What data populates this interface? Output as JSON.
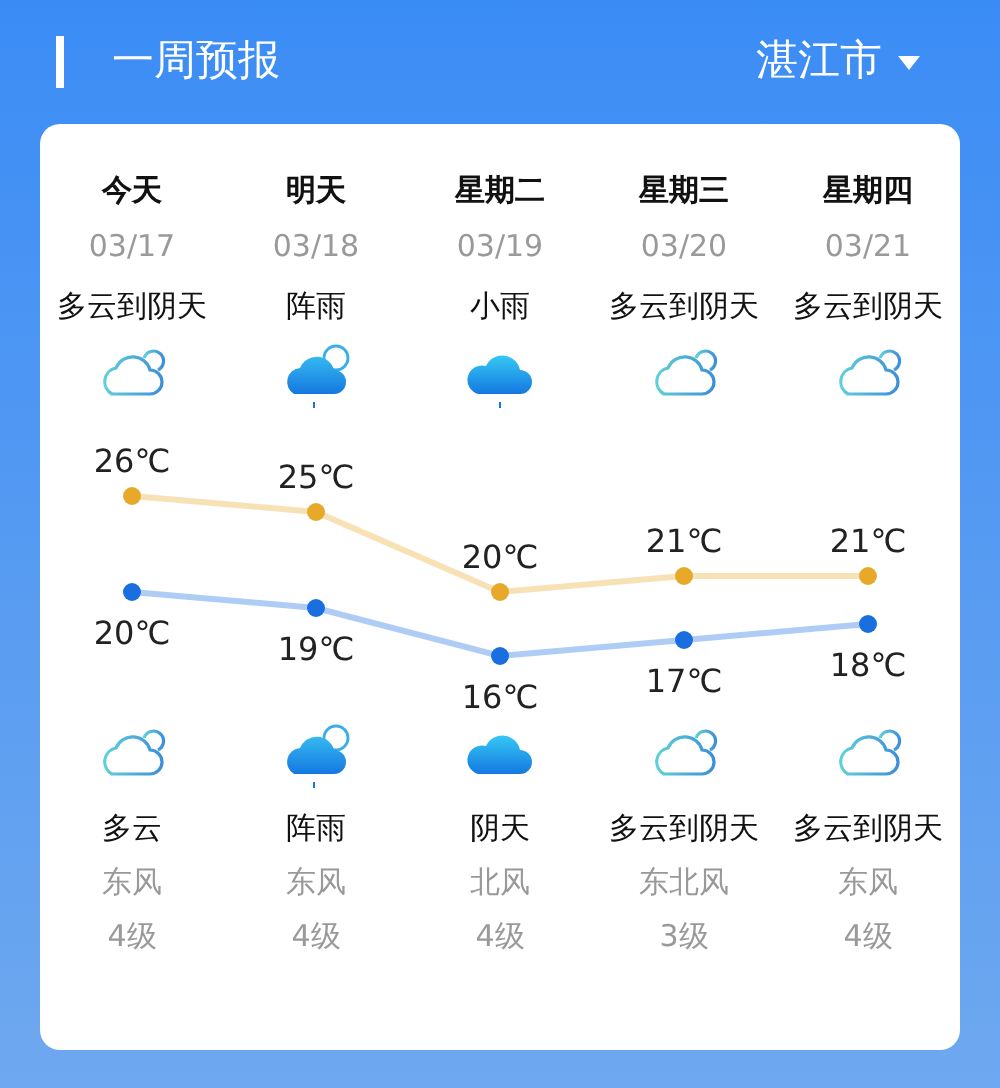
{
  "header": {
    "title": "一周预报",
    "city": "湛江市"
  },
  "days": [
    {
      "name": "今天",
      "date": "03/17",
      "day_weather": "多云到阴天",
      "day_icon": {
        "kind": "cloudy-sun"
      },
      "night_icon": {
        "kind": "cloudy-sun"
      },
      "night_weather": "多云",
      "wind": "东风",
      "wind_level": "4级"
    },
    {
      "name": "明天",
      "date": "03/18",
      "day_weather": "阵雨",
      "day_icon": {
        "kind": "shower"
      },
      "night_icon": {
        "kind": "shower"
      },
      "night_weather": "阵雨",
      "wind": "东风",
      "wind_level": "4级"
    },
    {
      "name": "星期二",
      "date": "03/19",
      "day_weather": "小雨",
      "day_icon": {
        "kind": "rain"
      },
      "night_icon": {
        "kind": "overcast"
      },
      "night_weather": "阴天",
      "wind": "北风",
      "wind_level": "4级"
    },
    {
      "name": "星期三",
      "date": "03/20",
      "day_weather": "多云到阴天",
      "day_icon": {
        "kind": "cloudy-sun"
      },
      "night_icon": {
        "kind": "cloudy-sun"
      },
      "night_weather": "多云到阴天",
      "wind": "东北风",
      "wind_level": "3级"
    },
    {
      "name": "星期四",
      "date": "03/21",
      "day_weather": "多云到阴天",
      "day_icon": {
        "kind": "cloudy-sun"
      },
      "night_icon": {
        "kind": "cloudy-sun"
      },
      "night_weather": "多云到阴天",
      "wind": "东风",
      "wind_level": "4级"
    }
  ],
  "chart_data": {
    "type": "line",
    "series": [
      {
        "color": "#e8a92a",
        "marker": true,
        "values": [
          26,
          25,
          20,
          21,
          21
        ],
        "value_labels": [
          "26℃",
          "25℃",
          "20℃",
          "21℃",
          "21℃"
        ]
      },
      {
        "color": "#1a6fe0",
        "marker": true,
        "values": [
          20,
          19,
          16,
          17,
          18
        ],
        "value_labels": [
          "20℃",
          "19℃",
          "16℃",
          "17℃",
          "18℃"
        ]
      }
    ]
  }
}
